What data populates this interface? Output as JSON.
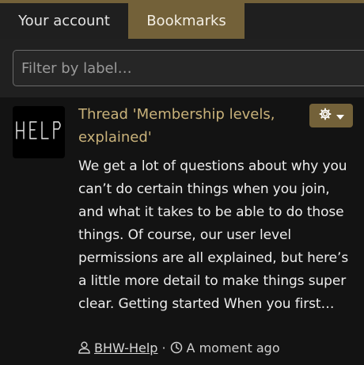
{
  "tabs": [
    {
      "label": "Your account",
      "active": false
    },
    {
      "label": "Bookmarks",
      "active": true
    }
  ],
  "filter": {
    "placeholder": "Filter by label…",
    "value": ""
  },
  "bookmark": {
    "avatar_text": "HELP",
    "title": "Thread 'Membership levels, explained'",
    "snippet": "We get a lot of questions about why you can’t do certain things when you join, and what it takes to be able to do those things. Of course, our user level permissions are all explained, but here’s a little more detail to make things super clear. Getting started When you first…",
    "author": "BHW-Help",
    "separator": "·",
    "time": "A moment ago",
    "icons": {
      "author": "user-icon",
      "time": "clock-icon",
      "menu": "gear-icon",
      "caret": "caret-down-icon"
    }
  },
  "colors": {
    "accent": "#736139",
    "link": "#c9b27a",
    "background": "#131313",
    "panel": "#202020"
  }
}
